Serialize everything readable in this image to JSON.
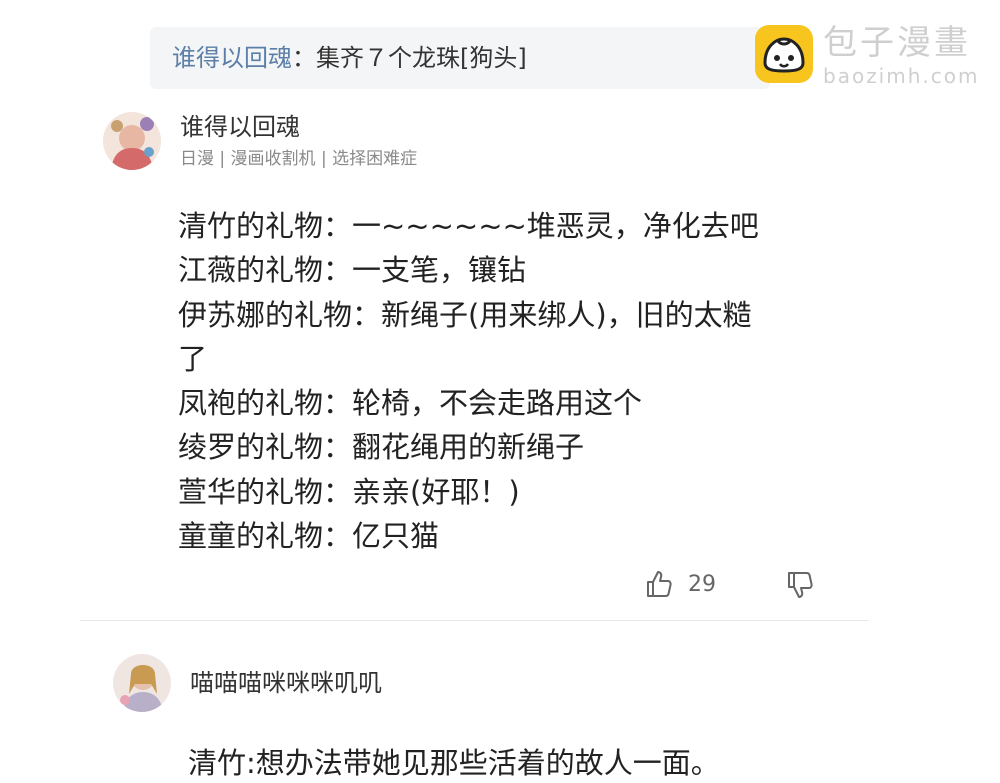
{
  "quote": {
    "username": "谁得以回魂",
    "separator": "：",
    "text": "集齐７个龙珠[狗头]"
  },
  "watermark": {
    "title": "包子漫畫",
    "domain": "baozimh.com",
    "logo_color": "#f7c51e"
  },
  "comment1": {
    "username": "谁得以回魂",
    "tags": "日漫 | 漫画收割机 | 选择困难症",
    "lines": [
      "清竹的礼物：一~~~~~~堆恶灵，净化去吧",
      "江薇的礼物：一支笔，镶钻",
      "伊苏娜的礼物：新绳子(用来绑人)，旧的太糙",
      "了",
      "凤袍的礼物：轮椅，不会走路用这个",
      "绫罗的礼物：翻花绳用的新绳子",
      "萱华的礼物：亲亲(好耶！)",
      "童童的礼物：亿只猫"
    ],
    "like_count": "29",
    "like_icon": "thumbs-up-icon",
    "dislike_icon": "thumbs-down-icon"
  },
  "comment2": {
    "username": "喵喵喵咪咪咪叽叽",
    "text": "清竹:想办法带她见那些活着的故人一面。"
  },
  "colors": {
    "username_link": "#5b7fa8",
    "quote_bg": "#f4f5f7",
    "muted_text": "#8a8a8a"
  }
}
